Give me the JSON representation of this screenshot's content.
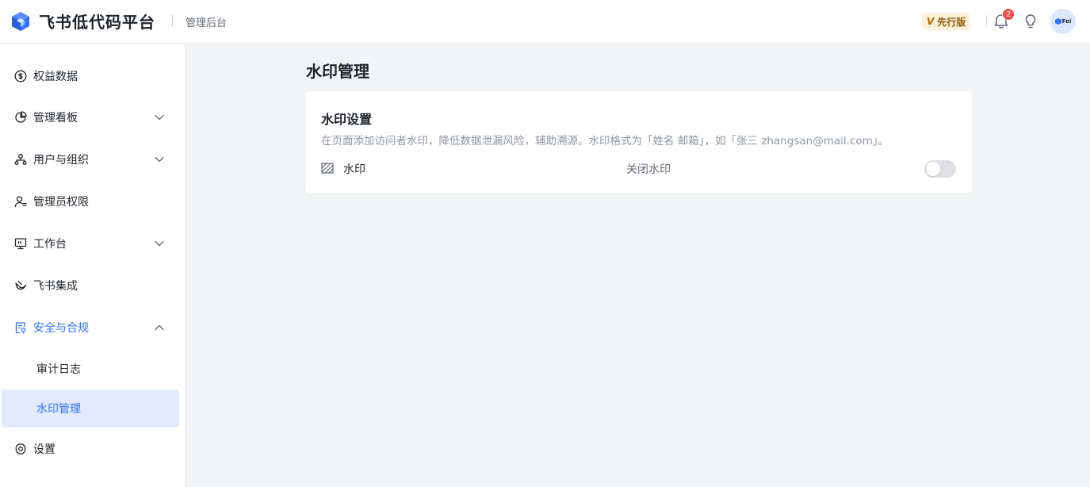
{
  "header": {
    "app_title": "飞书低代码平台",
    "subtitle": "管理后台",
    "preview_badge": {
      "icon_text": "V",
      "label": "先行版"
    },
    "notification_count": "2",
    "avatar_text": "Fei"
  },
  "sidebar": {
    "items": [
      {
        "label": "权益数据",
        "icon": "dollar-circle-icon"
      },
      {
        "label": "管理看板",
        "icon": "pie-chart-icon",
        "expandable": true
      },
      {
        "label": "用户与组织",
        "icon": "org-tree-icon",
        "expandable": true
      },
      {
        "label": "管理员权限",
        "icon": "admin-user-icon"
      },
      {
        "label": "工作台",
        "icon": "monitor-icon",
        "expandable": true
      },
      {
        "label": "飞书集成",
        "icon": "feishu-integration-icon"
      },
      {
        "label": "安全与合规",
        "icon": "security-compliance-icon",
        "expanded": true,
        "active": true
      },
      {
        "label": "设置",
        "icon": "gear-icon"
      }
    ],
    "security_sub_items": [
      {
        "label": "审计日志"
      },
      {
        "label": "水印管理",
        "selected": true
      }
    ]
  },
  "main": {
    "page_title": "水印管理",
    "card": {
      "title": "水印设置",
      "description": "在页面添加访问者水印，降低数据泄漏风险，辅助溯源。水印格式为「姓名 邮箱」，如「张三 zhangsan@mail.com」。",
      "watermark_label": "水印",
      "status_text": "关闭水印",
      "toggle_on": false
    }
  },
  "colors": {
    "accent": "#3370ff",
    "selected_bg": "#e1eaff",
    "badge_red": "#f54a45",
    "page_bg": "#f2f3f5"
  }
}
